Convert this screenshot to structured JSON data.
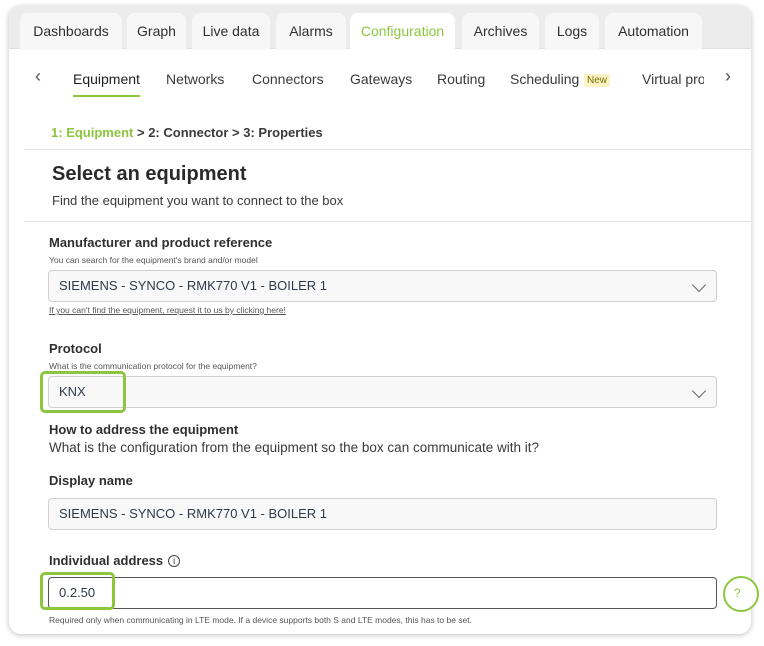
{
  "tabs": [
    {
      "label": "Dashboards"
    },
    {
      "label": "Graph"
    },
    {
      "label": "Live data"
    },
    {
      "label": "Alarms"
    },
    {
      "label": "Configuration"
    },
    {
      "label": "Archives"
    },
    {
      "label": "Logs"
    },
    {
      "label": "Automation"
    }
  ],
  "active_tab": "Configuration",
  "subnav": {
    "items": [
      {
        "label": "Equipment"
      },
      {
        "label": "Networks"
      },
      {
        "label": "Connectors"
      },
      {
        "label": "Gateways"
      },
      {
        "label": "Routing"
      },
      {
        "label": "Scheduling"
      },
      {
        "label": "Virtual prop"
      }
    ],
    "new_badge": "New",
    "prev_arrow": "‹",
    "next_arrow": "›"
  },
  "breadcrumb": {
    "step1_num": "1:",
    "step1": "Equipment",
    "sep1": ">",
    "step2_num": "2:",
    "step2": "Connector",
    "sep2": ">",
    "step3_num": "3:",
    "step3": "Properties"
  },
  "section": {
    "title": "Select an equipment",
    "subtitle": "Find the equipment you want to connect to the box"
  },
  "manufacturer": {
    "label": "Manufacturer and product reference",
    "hint": "You can search for the equipment's brand and/or model",
    "value": "SIEMENS - SYNCO - RMK770 V1 - BOILER 1",
    "link": "If you can't find the equipment, request it to us by clicking here!"
  },
  "protocol": {
    "label": "Protocol",
    "hint": "What is the communication protocol for the equipment?",
    "value": "KNX"
  },
  "addressing": {
    "label": "How to address the equipment",
    "description": "What is the configuration from the equipment so the box can communicate with it?"
  },
  "display_name": {
    "label": "Display name",
    "value": "SIEMENS - SYNCO - RMK770 V1 - BOILER 1"
  },
  "individual_address": {
    "label": "Individual address",
    "info_glyph": "i",
    "value": "0.2.50",
    "note": "Required only when communicating in LTE mode. If a device supports both S and LTE modes, this has to be set."
  },
  "help_glyph": "?",
  "colors": {
    "accent": "#8cc63f",
    "highlight": "#8cc63f",
    "tab_bar": "#ececec"
  }
}
